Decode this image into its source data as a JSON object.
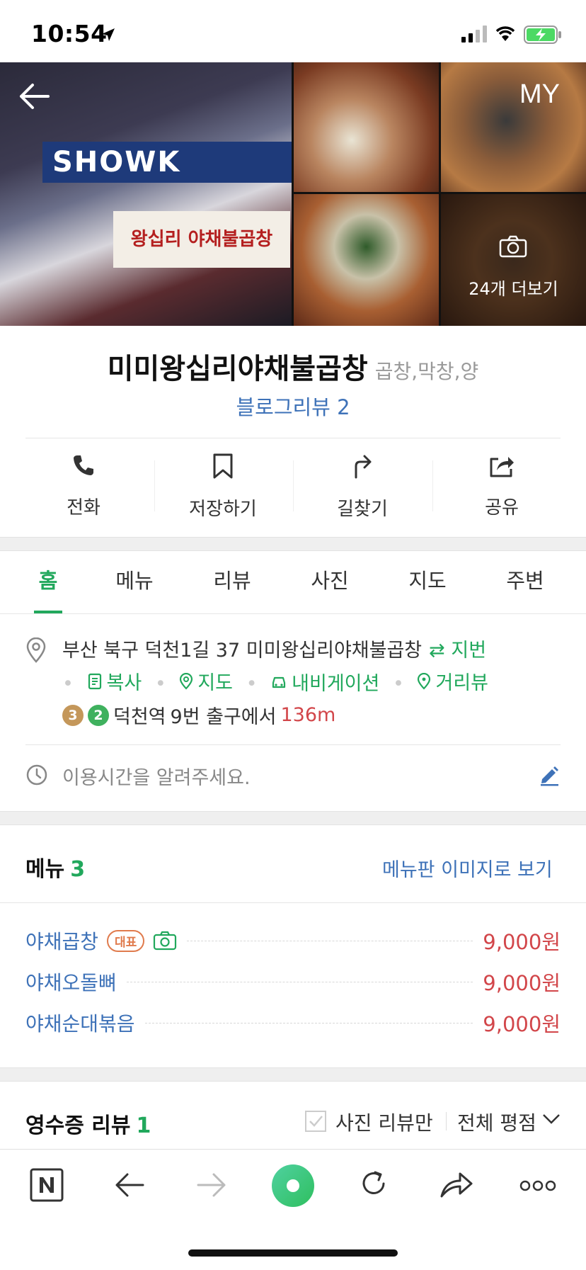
{
  "status_bar": {
    "time": "10:54"
  },
  "header": {
    "my_label": "MY",
    "photo_more_label": "24개 더보기"
  },
  "place": {
    "name": "미미왕십리야채불곱창",
    "category": "곱창,막창,양",
    "blog_review": "블로그리뷰 2"
  },
  "actions": [
    {
      "label": "전화",
      "icon": "phone-icon"
    },
    {
      "label": "저장하기",
      "icon": "bookmark-icon"
    },
    {
      "label": "길찾기",
      "icon": "directions-icon"
    },
    {
      "label": "공유",
      "icon": "share-icon"
    }
  ],
  "tabs": [
    "홈",
    "메뉴",
    "리뷰",
    "사진",
    "지도",
    "주변"
  ],
  "address": {
    "text": "부산 북구 덕천1길 37 미미왕십리야채불곱창",
    "jibun_label": "⇄ 지번",
    "links": [
      "복사",
      "지도",
      "내비게이션",
      "거리뷰"
    ],
    "subway_lines": [
      "3",
      "2"
    ],
    "station": "덕천역",
    "exit_text": "9번 출구에서",
    "distance": "136m"
  },
  "hours_prompt": "이용시간을 알려주세요.",
  "menu": {
    "title": "메뉴",
    "count": "3",
    "image_link": "메뉴판 이미지로 보기",
    "rep_badge": "대표",
    "items": [
      {
        "name": "야채곱창",
        "price": "9,000원"
      },
      {
        "name": "야채오돌뼈",
        "price": "9,000원"
      },
      {
        "name": "야채순대볶음",
        "price": "9,000원"
      }
    ]
  },
  "receipt_review": {
    "title": "영수증 리뷰",
    "count": "1",
    "photo_only_label": "사진 리뷰만",
    "all_rating_label": "전체 평점"
  },
  "colors": {
    "green": "#21a85c",
    "blue_link": "#3e72b8",
    "price_red": "#d2464a",
    "line3": "#c4975a",
    "line2": "#3fb15e"
  }
}
